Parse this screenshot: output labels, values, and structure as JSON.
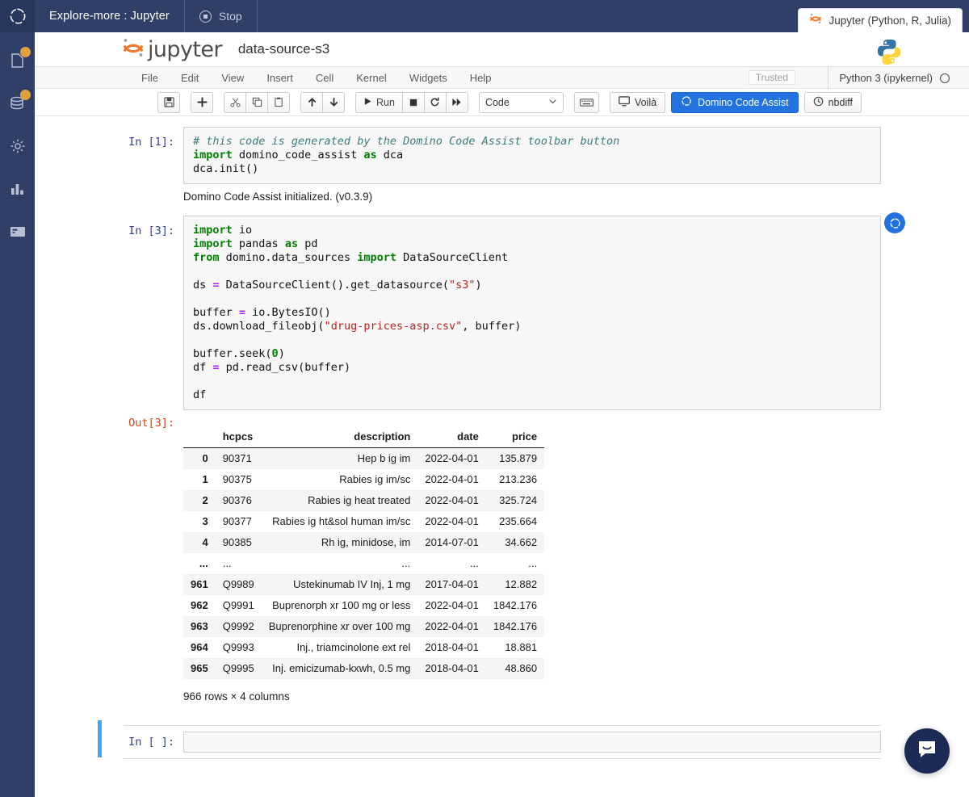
{
  "topbar": {
    "workspace_title": "Explore-more : Jupyter",
    "stop_label": "Stop",
    "stop_icon": "stop-circle-icon",
    "domino_logo_icon": "domino-logo-icon",
    "kernel_tab_label": "Jupyter (Python, R, Julia)",
    "kernel_tab_icon": "jupyter-icon",
    "bg_color": "#2f3f68"
  },
  "rail": {
    "items": [
      {
        "icon": "files-icon",
        "badge": true
      },
      {
        "icon": "database-icon",
        "badge": true
      },
      {
        "icon": "gear-icon",
        "badge": false
      },
      {
        "icon": "bar-chart-icon",
        "badge": false
      },
      {
        "icon": "terminal-card-icon",
        "badge": false
      }
    ],
    "badge_color": "#e2a03f"
  },
  "jupyter": {
    "wordmark": "jupyter",
    "notebook_name": "data-source-s3",
    "python_logo_icon": "python-logo-icon",
    "menu": [
      "File",
      "Edit",
      "View",
      "Insert",
      "Cell",
      "Kernel",
      "Widgets",
      "Help"
    ],
    "trusted_label": "Trusted",
    "kernel_name": "Python 3 (ipykernel)",
    "kernel_status_icon": "kernel-idle-circle-icon"
  },
  "toolbar": {
    "save_icon": "save-icon",
    "add_icon": "plus-icon",
    "cut_icon": "scissors-icon",
    "copy_icon": "copy-icon",
    "paste_icon": "paste-icon",
    "move_up_icon": "arrow-up-icon",
    "move_down_icon": "arrow-down-icon",
    "run_label": "Run",
    "run_icon": "play-icon",
    "stop_icon": "square-stop-icon",
    "restart_icon": "restart-icon",
    "fastforward_icon": "fast-forward-icon",
    "cell_type_value": "Code",
    "cell_type_caret": "chevron-down-icon",
    "keyboard_icon": "keyboard-icon",
    "voila_label": "Voilà",
    "voila_icon": "monitor-icon",
    "dca_label": "Domino Code Assist",
    "dca_icon": "domino-spinner-icon",
    "nbdiff_label": "nbdiff",
    "nbdiff_icon": "clock-icon",
    "dca_accent": "#2272e0"
  },
  "cells": [
    {
      "prompt": "In [1]:",
      "code_lines": [
        [
          {
            "t": "# this code is generated by the Domino Code Assist toolbar button",
            "c": "c"
          }
        ],
        [
          {
            "t": "import",
            "c": "k"
          },
          {
            "t": " domino_code_assist ",
            "c": ""
          },
          {
            "t": "as",
            "c": "k"
          },
          {
            "t": " dca",
            "c": ""
          }
        ],
        [
          {
            "t": "dca.init()",
            "c": ""
          }
        ]
      ],
      "text_output": "Domino Code Assist initialized. (v0.3.9)"
    },
    {
      "prompt": "In [3]:",
      "code_lines": [
        [
          {
            "t": "import",
            "c": "k"
          },
          {
            "t": " io",
            "c": ""
          }
        ],
        [
          {
            "t": "import",
            "c": "k"
          },
          {
            "t": " pandas ",
            "c": ""
          },
          {
            "t": "as",
            "c": "k"
          },
          {
            "t": " pd",
            "c": ""
          }
        ],
        [
          {
            "t": "from",
            "c": "k"
          },
          {
            "t": " domino.data_sources ",
            "c": ""
          },
          {
            "t": "import",
            "c": "k"
          },
          {
            "t": " DataSourceClient",
            "c": ""
          }
        ],
        [
          {
            "t": "",
            "c": ""
          }
        ],
        [
          {
            "t": "ds ",
            "c": ""
          },
          {
            "t": "=",
            "c": "o"
          },
          {
            "t": " DataSourceClient().get_datasource(",
            "c": ""
          },
          {
            "t": "\"s3\"",
            "c": "s"
          },
          {
            "t": ")",
            "c": ""
          }
        ],
        [
          {
            "t": "",
            "c": ""
          }
        ],
        [
          {
            "t": "buffer ",
            "c": ""
          },
          {
            "t": "=",
            "c": "o"
          },
          {
            "t": " io.BytesIO()",
            "c": ""
          }
        ],
        [
          {
            "t": "ds.download_fileobj(",
            "c": ""
          },
          {
            "t": "\"drug-prices-asp.csv\"",
            "c": "s"
          },
          {
            "t": ", buffer)",
            "c": ""
          }
        ],
        [
          {
            "t": "",
            "c": ""
          }
        ],
        [
          {
            "t": "buffer.seek(",
            "c": ""
          },
          {
            "t": "0",
            "c": "n"
          },
          {
            "t": ")",
            "c": ""
          }
        ],
        [
          {
            "t": "df ",
            "c": ""
          },
          {
            "t": "=",
            "c": "o"
          },
          {
            "t": " pd.read_csv(buffer)",
            "c": ""
          }
        ],
        [
          {
            "t": "",
            "c": ""
          }
        ],
        [
          {
            "t": "df",
            "c": ""
          }
        ]
      ],
      "marker_icon": "domino-run-marker-icon"
    }
  ],
  "output": {
    "prompt": "Out[3]:",
    "columns": [
      "",
      "hcpcs",
      "description",
      "date",
      "price"
    ],
    "rows": [
      [
        "0",
        "90371",
        "Hep b ig im",
        "2022-04-01",
        "135.879"
      ],
      [
        "1",
        "90375",
        "Rabies ig im/sc",
        "2022-04-01",
        "213.236"
      ],
      [
        "2",
        "90376",
        "Rabies ig heat treated",
        "2022-04-01",
        "325.724"
      ],
      [
        "3",
        "90377",
        "Rabies ig ht&sol human im/sc",
        "2022-04-01",
        "235.664"
      ],
      [
        "4",
        "90385",
        "Rh ig, minidose, im",
        "2014-07-01",
        "34.662"
      ],
      [
        "...",
        "...",
        "...",
        "...",
        "..."
      ],
      [
        "961",
        "Q9989",
        "Ustekinumab IV Inj, 1 mg",
        "2017-04-01",
        "12.882"
      ],
      [
        "962",
        "Q9991",
        "Buprenorph xr 100 mg or less",
        "2022-04-01",
        "1842.176"
      ],
      [
        "963",
        "Q9992",
        "Buprenorphine xr over 100 mg",
        "2022-04-01",
        "1842.176"
      ],
      [
        "964",
        "Q9993",
        "Inj., triamcinolone ext rel",
        "2018-04-01",
        "18.881"
      ],
      [
        "965",
        "Q9995",
        "Inj. emicizumab-kxwh, 0.5 mg",
        "2018-04-01",
        "48.860"
      ]
    ],
    "shape_label": "966 rows × 4 columns"
  },
  "empty_cell": {
    "prompt": "In [ ]:",
    "value": "",
    "selected_color": "#42a5f5"
  },
  "intercom": {
    "icon": "chat-bubble-icon",
    "color": "#1c2b55"
  }
}
